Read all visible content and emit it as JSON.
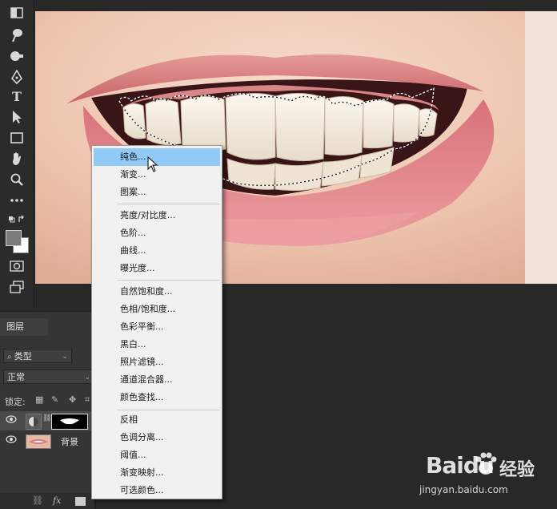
{
  "layers_panel": {
    "tab_label": "图层",
    "filter_kind": "类型",
    "blend_mode": "正常",
    "lock_label": "锁定:",
    "layers": [
      {
        "name": ""
      },
      {
        "name": "背景"
      }
    ],
    "bottom_icons": [
      "link-icon",
      "fx-icon",
      "mask-icon"
    ],
    "fx_label": "fx"
  },
  "adjustment_menu": {
    "groups": [
      [
        "纯色...",
        "渐变...",
        "图案..."
      ],
      [
        "亮度/对比度...",
        "色阶...",
        "曲线...",
        "曝光度..."
      ],
      [
        "自然饱和度...",
        "色相/饱和度...",
        "色彩平衡...",
        "黑白...",
        "照片滤镜...",
        "通道混合器...",
        "颜色查找..."
      ],
      [
        "反相",
        "色调分离...",
        "阈值...",
        "渐变映射...",
        "可选颜色..."
      ]
    ],
    "highlighted": "纯色..."
  },
  "tools": [
    "gradient-tool-icon",
    "smudge-tool-icon",
    "dodge-tool-icon",
    "pen-tool-icon",
    "type-tool-icon",
    "path-select-tool-icon",
    "rectangle-tool-icon",
    "hand-tool-icon",
    "zoom-tool-icon",
    "more-tools-icon",
    "swap-colors-icon",
    "color-swatches",
    "quick-mask-icon",
    "screen-mode-icon"
  ],
  "type_tool_glyph": "T",
  "watermark": {
    "brand": "Baidu",
    "brand_cn": "经验",
    "url": "jingyan.baidu.com"
  },
  "colors": {
    "highlight": "#91c9f7",
    "menu_bg": "#f1f1f1",
    "panel_bg": "#353535",
    "app_bg": "#282828"
  }
}
